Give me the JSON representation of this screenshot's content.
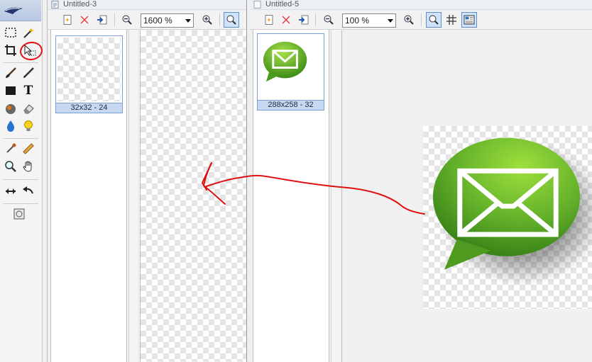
{
  "toolbox": {
    "tools": [
      "marquee-select-icon",
      "magic-wand-icon",
      "crop-icon",
      "move-selection-icon",
      "brush-icon",
      "pencil-icon",
      "rectangle-icon",
      "text-icon",
      "fill-icon",
      "eraser-icon",
      "drop-icon",
      "bulb-icon",
      "eyedropper-icon",
      "ruler-icon",
      "zoom-tool-icon",
      "hand-icon",
      "swap-icon",
      "undo-icon",
      "canvas-icon"
    ],
    "text_tool_glyph": "T"
  },
  "doc_left": {
    "title": "Untitled-3",
    "zoom": "1600 %",
    "thumbnails": [
      {
        "label": "32x32 - 24"
      }
    ]
  },
  "doc_right": {
    "title": "Untitled-5",
    "zoom": "100 %",
    "thumbnails": [
      {
        "label": "288x258 - 32"
      }
    ]
  },
  "colors": {
    "annotation_red": "#e01010",
    "icon_green_light": "#8fd23a",
    "icon_green_dark": "#3f8f1a",
    "thumb_selected": "#c6d8f2"
  }
}
